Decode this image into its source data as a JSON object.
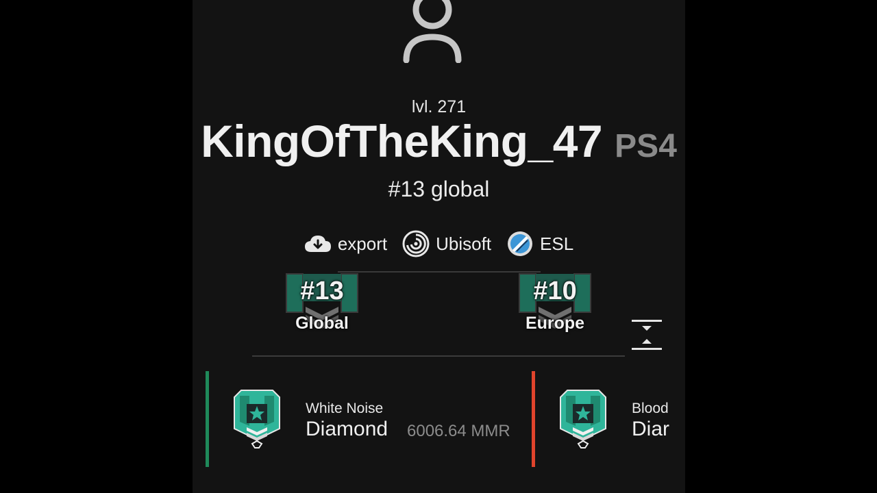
{
  "profile": {
    "level": "lvl. 271",
    "username": "KingOfTheKing_47",
    "platform": "PS4",
    "global_rank": "#13 global"
  },
  "links": [
    {
      "label": "export",
      "icon": "cloud-download-icon"
    },
    {
      "label": "Ubisoft",
      "icon": "ubisoft-logo-icon"
    },
    {
      "label": "ESL",
      "icon": "esl-logo-icon"
    }
  ],
  "leaderboard": [
    {
      "rank": "#13",
      "scope": "Global",
      "icon": "diamond-rank-badge-icon"
    },
    {
      "rank": "#10",
      "scope": "Europe",
      "icon": "diamond-rank-badge-icon"
    }
  ],
  "controls": {
    "collapse_icon": "collapse-vertical-icon"
  },
  "seasons": [
    {
      "season": "White Noise",
      "rank": "Diamond",
      "mmr": "6006.64 MMR",
      "accent": "#1f8a5a"
    },
    {
      "season": "Blood",
      "rank": "Diar",
      "mmr": "",
      "accent": "#e0442c"
    }
  ],
  "colors": {
    "background": "#131313",
    "diamond_teal": "#2fb59a",
    "platform_gray": "#8a8a8a"
  }
}
